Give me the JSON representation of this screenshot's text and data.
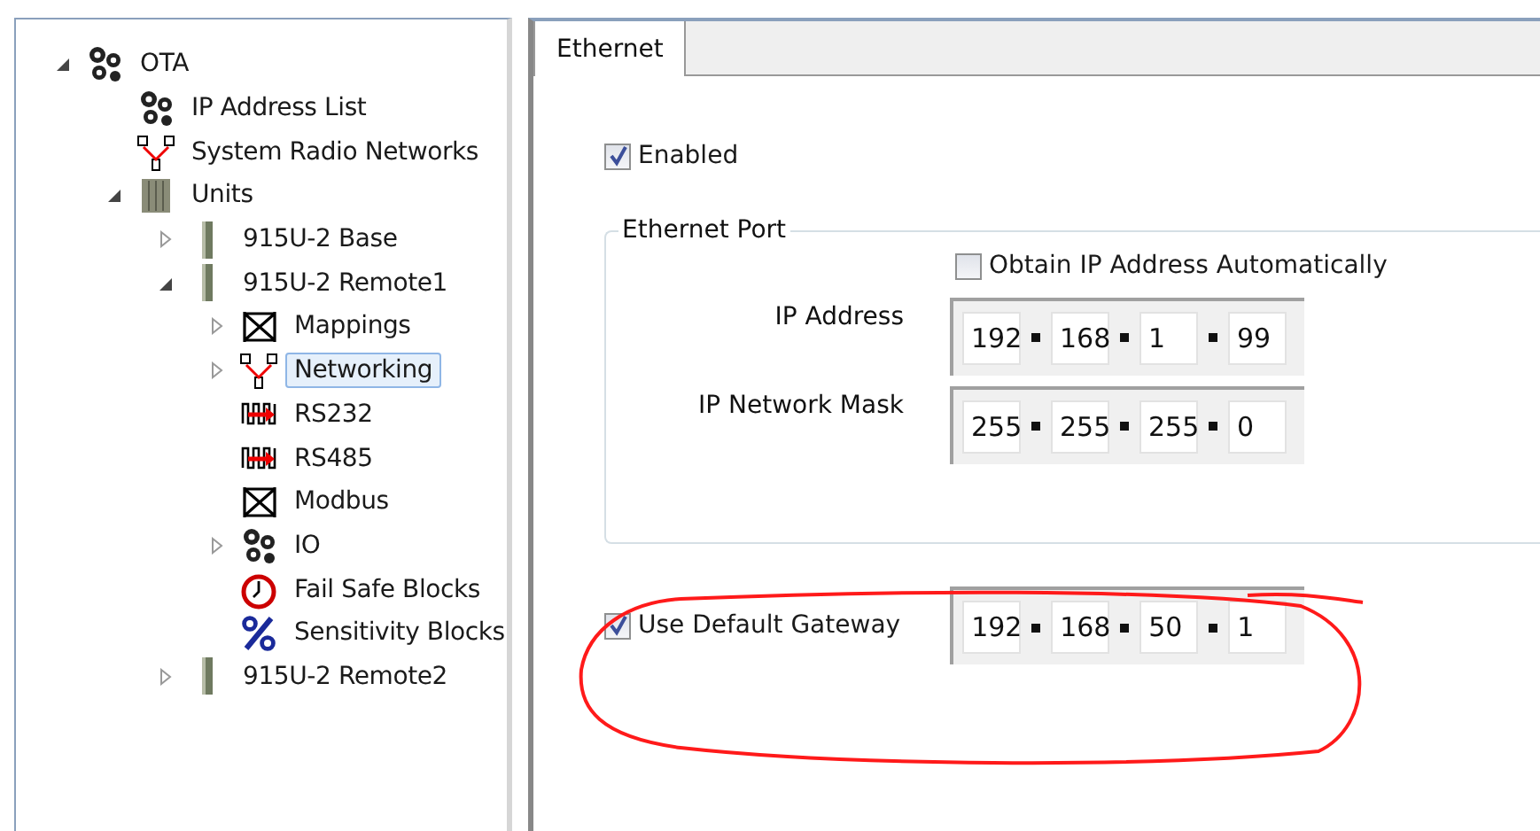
{
  "tree": [
    {
      "label": "OTA",
      "kind": "gears",
      "expanded": true,
      "selected": false,
      "children": [
        {
          "label": "IP Address List",
          "kind": "gears",
          "selected": false
        },
        {
          "label": "System Radio Networks",
          "kind": "network",
          "selected": false
        },
        {
          "label": "Units",
          "kind": "rack",
          "expanded": true,
          "selected": false,
          "children": [
            {
              "label": "915U-2 Base",
              "kind": "unit",
              "expanded": false,
              "selected": false
            },
            {
              "label": "915U-2 Remote1",
              "kind": "unit",
              "expanded": true,
              "selected": false,
              "children": [
                {
                  "label": "Mappings",
                  "kind": "mapping",
                  "expanded": false,
                  "selected": false
                },
                {
                  "label": "Networking",
                  "kind": "network",
                  "expanded": false,
                  "selected": true
                },
                {
                  "label": "RS232",
                  "kind": "serial",
                  "selected": false
                },
                {
                  "label": "RS485",
                  "kind": "serial",
                  "selected": false
                },
                {
                  "label": "Modbus",
                  "kind": "mapping",
                  "selected": false
                },
                {
                  "label": "IO",
                  "kind": "gears",
                  "expanded": false,
                  "selected": false
                },
                {
                  "label": "Fail Safe Blocks",
                  "kind": "clock",
                  "selected": false
                },
                {
                  "label": "Sensitivity Blocks",
                  "kind": "percent",
                  "selected": false
                }
              ]
            },
            {
              "label": "915U-2 Remote2",
              "kind": "unit",
              "expanded": false,
              "selected": false
            }
          ]
        }
      ]
    }
  ],
  "tabs": [
    {
      "label": "Ethernet",
      "selected": true
    }
  ],
  "enabled": {
    "label": "Enabled",
    "checked": true
  },
  "ethernet_port": {
    "title": "Ethernet Port",
    "obtain_automatically": {
      "label": "Obtain IP Address Automatically",
      "checked": false
    },
    "fields": [
      {
        "label": "IP Address",
        "octets": [
          "192",
          "168",
          "1",
          "99"
        ]
      },
      {
        "label": "IP Network Mask",
        "octets": [
          "255",
          "255",
          "255",
          "0"
        ]
      }
    ]
  },
  "default_gateway": {
    "label": "Use Default Gateway",
    "checked": true,
    "octets": [
      "192",
      "168",
      "50",
      "1"
    ],
    "circled": true
  }
}
